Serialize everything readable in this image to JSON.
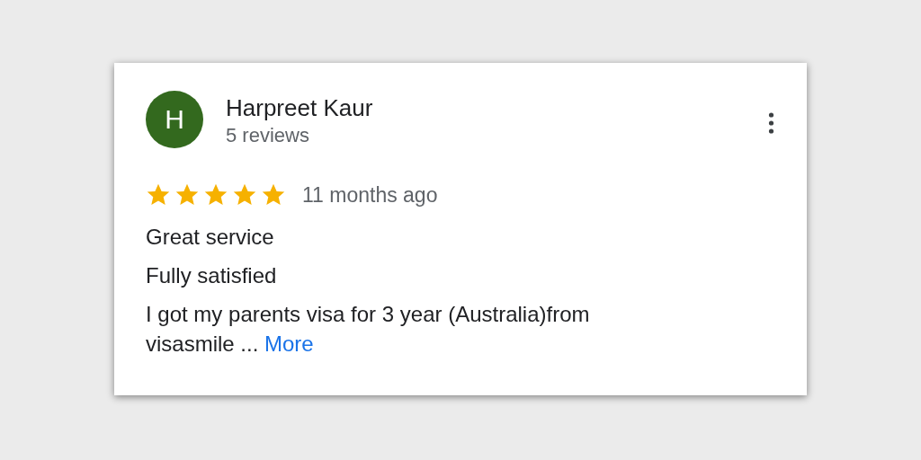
{
  "review": {
    "avatar_initial": "H",
    "name": "Harpreet Kaur",
    "review_count": "5 reviews",
    "stars": 5,
    "time": "11 months ago",
    "lines": [
      "Great service",
      "Fully satisfied",
      "I got my parents visa for 3 year (Australia)from visasmile ..."
    ],
    "more_link": "More"
  }
}
